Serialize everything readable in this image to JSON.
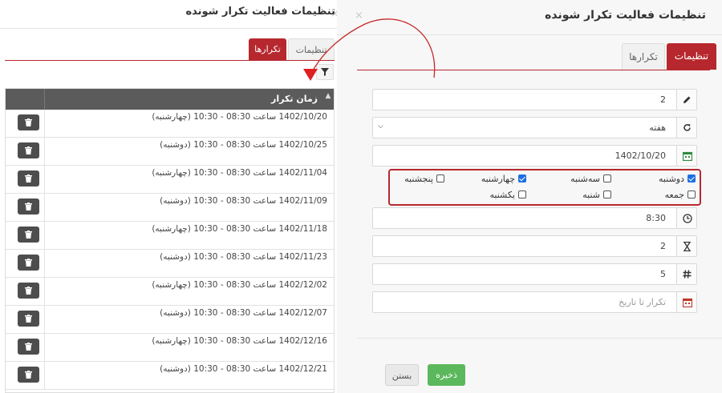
{
  "left_panel": {
    "title": "تنظیمات فعالیت تکرار شونده",
    "close": "×",
    "tabs": {
      "repeats": "تکرارها",
      "settings": "تنظیمات"
    },
    "grid": {
      "header_time": "زمان تکرار",
      "rows": [
        "1402/10/20 ساعت 08:30 - 10:30 (چهارشنبه)",
        "1402/10/25 ساعت 08:30 - 10:30 (دوشنبه)",
        "1402/11/04 ساعت 08:30 - 10:30 (چهارشنبه)",
        "1402/11/09 ساعت 08:30 - 10:30 (دوشنبه)",
        "1402/11/18 ساعت 08:30 - 10:30 (چهارشنبه)",
        "1402/11/23 ساعت 08:30 - 10:30 (دوشنبه)",
        "1402/12/02 ساعت 08:30 - 10:30 (چهارشنبه)",
        "1402/12/07 ساعت 08:30 - 10:30 (دوشنبه)",
        "1402/12/16 ساعت 08:30 - 10:30 (چهارشنبه)",
        "1402/12/21 ساعت 08:30 - 10:30 (دوشنبه)"
      ]
    }
  },
  "right_panel": {
    "title": "تنظیمات فعالیت تکرار شونده",
    "close": "×",
    "tabs": {
      "settings": "تنظیمات",
      "repeats": "تکرارها"
    },
    "fields": {
      "interval": "2",
      "frequency": "هفته",
      "start_date": "1402/10/20",
      "start_time": "8:30",
      "duration": "2",
      "count": "5",
      "until_placeholder": "تکرار تا تاریخ"
    },
    "days": {
      "monday": {
        "label": "دوشنبه",
        "checked": true
      },
      "tuesday": {
        "label": "سه‌شنبه",
        "checked": false
      },
      "wednesday": {
        "label": "چهارشنبه",
        "checked": true
      },
      "thursday": {
        "label": "پنجشنبه",
        "checked": false
      },
      "friday": {
        "label": "جمعه",
        "checked": false
      },
      "saturday": {
        "label": "شنبه",
        "checked": false
      },
      "sunday": {
        "label": "یکشنبه",
        "checked": false
      }
    },
    "buttons": {
      "save": "ذخیره",
      "close": "بستن"
    }
  },
  "colors": {
    "accent": "#b7282e",
    "save": "#5cb85c",
    "grid_header": "#5b5b5b",
    "checkbox": "#1e6fe0"
  }
}
